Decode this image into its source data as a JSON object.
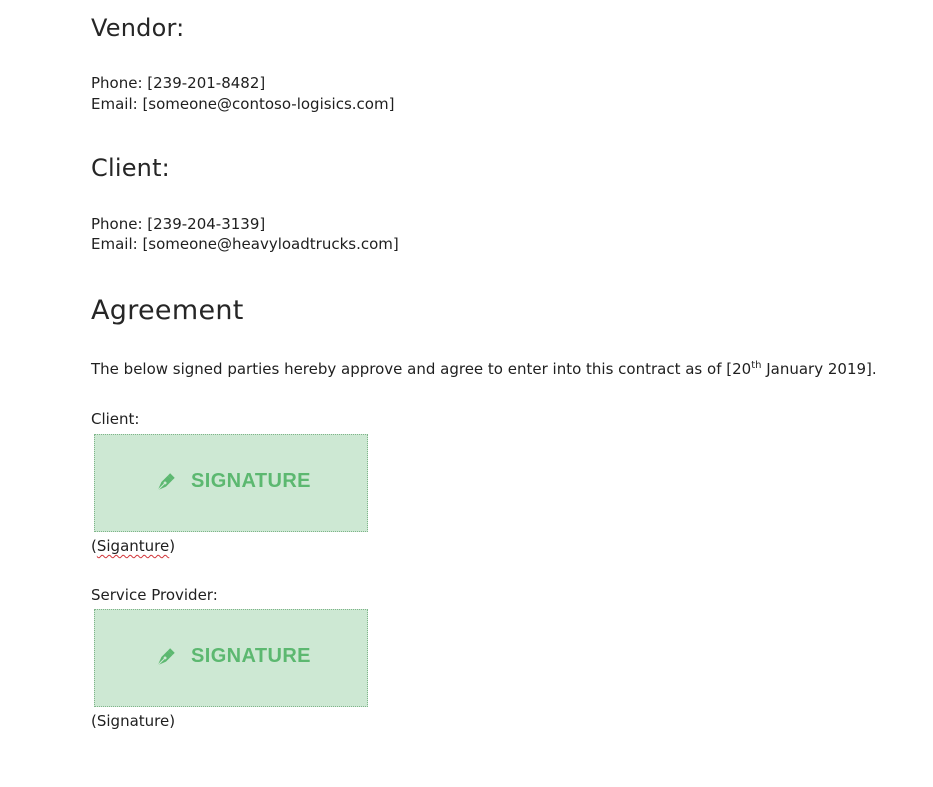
{
  "vendor": {
    "heading": "Vendor:",
    "phone": "Phone: [239-201-8482]",
    "email": "Email: [someone@contoso-logisics.com]"
  },
  "client": {
    "heading": "Client:",
    "phone": "Phone: [239-204-3139]",
    "email": "Email: [someone@heavyloadtrucks.com]"
  },
  "agreement": {
    "heading": "Agreement",
    "text_before": "The below signed parties hereby approve and agree to enter into this contract as of [20",
    "text_sup": "th",
    "text_after": " January 2019]."
  },
  "signatures": {
    "client_label": "Client:",
    "client_box_text": "SIGNATURE",
    "client_caption_open": "(",
    "client_caption_word": "Siganture",
    "client_caption_close": ")",
    "provider_label": "Service Provider:",
    "provider_box_text": "SIGNATURE",
    "provider_caption": "(Signature)",
    "icon": "pen-nib-icon",
    "accent_color": "#5cb870",
    "box_color": "#cde8d3"
  }
}
